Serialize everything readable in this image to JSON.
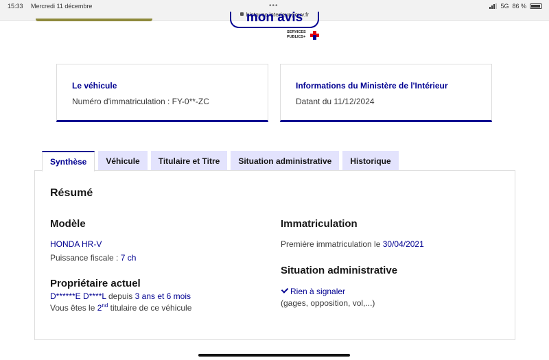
{
  "statusbar": {
    "time": "15:33",
    "date": "Mercredi 11 décembre",
    "url": "histovec.interieur.gouv.fr",
    "network": "5G",
    "battery": "86 %"
  },
  "header": {
    "avis_button": "mon avis",
    "logo_line1": "SERVICES",
    "logo_line2": "PUBLICS+"
  },
  "cards": [
    {
      "title": "Le véhicule",
      "text": "Numéro d'immatriculation : FY-0**-ZC"
    },
    {
      "title": "Informations du Ministère de l'Intérieur",
      "text": "Datant du 11/12/2024"
    }
  ],
  "tabs": [
    {
      "label": "Synthèse",
      "active": true
    },
    {
      "label": "Véhicule"
    },
    {
      "label": "Titulaire et Titre"
    },
    {
      "label": "Situation administrative"
    },
    {
      "label": "Historique"
    }
  ],
  "summary": {
    "title": "Résumé",
    "modele": {
      "title": "Modèle",
      "name": "HONDA HR-V",
      "puissance_label": "Puissance fiscale : ",
      "puissance_value": "7 ch"
    },
    "proprietaire": {
      "title": "Propriétaire actuel",
      "name": "D******E D****L",
      "depuis": " depuis ",
      "duration": "3 ans et 6 mois",
      "line2_a": "Vous êtes le ",
      "rank": "2",
      "rank_sup": "nd",
      "line2_b": " titulaire de ce véhicule"
    },
    "immatriculation": {
      "title": "Immatriculation",
      "label": "Première immatriculation le ",
      "date": "30/04/2021"
    },
    "situation": {
      "title": "Situation administrative",
      "status": "Rien à signaler",
      "details": "(gages, opposition, vol,...)"
    }
  }
}
